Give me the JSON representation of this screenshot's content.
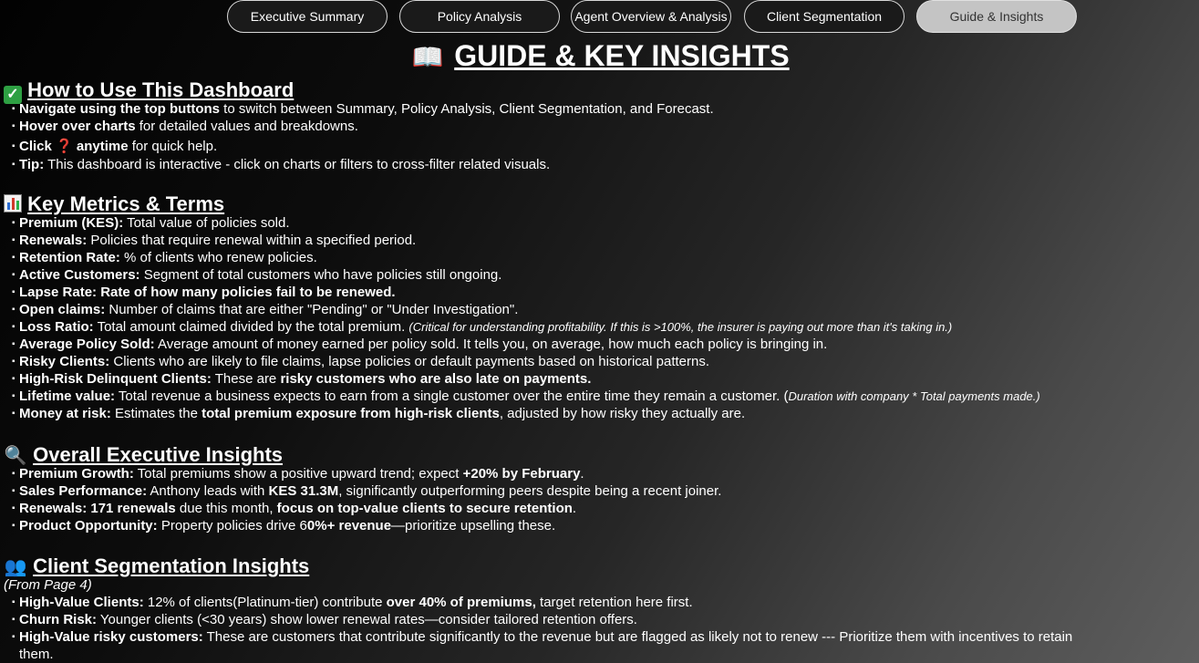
{
  "nav": {
    "tabs": [
      {
        "label": "Executive Summary"
      },
      {
        "label": "Policy Analysis"
      },
      {
        "label": "Agent Overview & Analysis"
      },
      {
        "label": "Client Segmentation"
      },
      {
        "label": "Guide & Insights",
        "active": true
      }
    ]
  },
  "page": {
    "title": "GUIDE & KEY INSIGHTS",
    "title_icon": "book-icon"
  },
  "howto": {
    "heading": "How to Use This Dashboard",
    "icon": "check-icon",
    "items": [
      {
        "b": "Navigate using the top buttons",
        "r": " to switch between Summary, Policy Analysis, Client Segmentation, and Forecast."
      },
      {
        "b": "Hover over charts",
        "r": " for detailed values and breakdowns."
      },
      {
        "b1": "Click ",
        "icon": "❓",
        "b2": " anytime",
        "r": " for quick help."
      },
      {
        "b": "Tip:",
        "r": " This dashboard is interactive - click on charts or filters to cross-filter related visuals."
      }
    ]
  },
  "metrics": {
    "heading": "Key Metrics & Terms",
    "icon": "bar-chart-icon",
    "items": [
      {
        "b": "Premium (KES):",
        "r": " Total value of policies sold."
      },
      {
        "b": "Renewals:",
        "r": " Policies that require renewal within a specified period."
      },
      {
        "b": "Retention Rate:",
        "r": " % of clients who renew policies."
      },
      {
        "b": "Active Customers:",
        "r": " Segment of total customers who have policies still ongoing."
      },
      {
        "b": "Lapse Rate: Rate of how many policies fail to be renewed.",
        "r": ""
      },
      {
        "b": "Open claims:",
        "r": " Number of claims that are either \"Pending\" or \"Under Investigation\"."
      },
      {
        "b": "Loss Ratio:",
        "r": " Total amount claimed divided by the total premium. ",
        "i": "(Critical for understanding profitability. If this is >100%, the insurer is paying out more than it's taking in.)"
      },
      {
        "b": "Average Policy Sold:",
        "r": " Average amount of money earned per policy sold. It tells you, on average, how much each policy is bringing in."
      },
      {
        "b": "Risky Clients:",
        "r": " Clients who are likely to file claims, lapse policies or default payments based on historical patterns."
      },
      {
        "b": "High-Risk Delinquent Clients:",
        "r": " These are ",
        "b2": "risky customers who are also late on payments."
      },
      {
        "b": "Lifetime value:",
        "r": "  Total revenue a business expects to earn from a single customer over the entire time they remain a customer. (",
        "i": "Duration with company * Total payments made.)"
      },
      {
        "b": "Money at risk:",
        "r": "  Estimates the ",
        "b2": "total premium exposure from high-risk clients",
        "r2": ", adjusted by how risky they actually are."
      }
    ]
  },
  "exec": {
    "heading": "Overall Executive Insights",
    "icon": "magnifier-icon",
    "items": [
      {
        "b": "Premium Growth:",
        "r": " Total premiums show a positive upward trend; expect ",
        "b2": "+20% by February",
        "r2": "."
      },
      {
        "b": "Sales Performance:",
        "r": " Anthony leads with ",
        "b2": "KES 31.3M",
        "r2": ", significantly outperforming peers despite being a recent joiner."
      },
      {
        "b": "Renewals: 171 renewals",
        "r": " due this month, ",
        "b2": "focus on top-value clients to secure retention",
        "r2": "."
      },
      {
        "b": "Product Opportunity:",
        "r": " Property policies drive 6",
        "b2": "0%+ revenue",
        "r2": "—prioritize upselling these."
      }
    ]
  },
  "segment": {
    "heading": "Client Segmentation Insights",
    "icon": "people-icon",
    "note": "(From Page 4)",
    "items": [
      {
        "b": "High-Value Clients:",
        "r": " 12% of clients(Platinum-tier) contribute ",
        "b2": "over 40% of premiums,",
        "r2": " target retention here first."
      },
      {
        "b": "Churn Risk:",
        "r": " Younger clients (<30 years) show lower renewal rates—consider tailored retention offers."
      },
      {
        "b": "High-Value risky customers:",
        "r": " These are customers that contribute significantly to the revenue but are flagged as likely not to renew --- Prioritize them with incentives to retain"
      },
      {
        "b": "",
        "r": "them."
      }
    ]
  }
}
